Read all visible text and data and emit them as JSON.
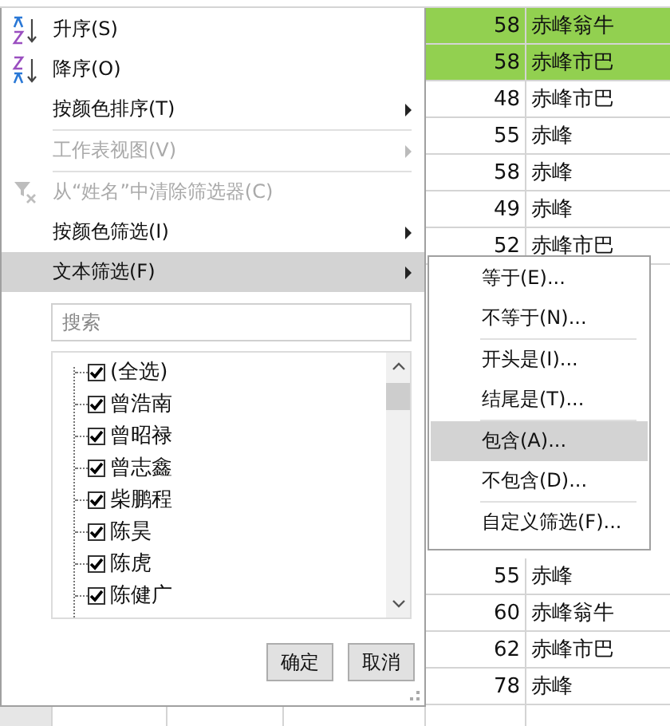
{
  "sheet": {
    "rows_top": [
      {
        "weight": "58",
        "address": "赤峰翁牛",
        "highlighted": true
      },
      {
        "weight": "58",
        "address": "赤峰市巴",
        "highlighted": true
      },
      {
        "weight": "48",
        "address": "赤峰市巴",
        "highlighted": false
      },
      {
        "weight": "55",
        "address": "赤峰",
        "highlighted": false
      },
      {
        "weight": "58",
        "address": "赤峰",
        "highlighted": false
      },
      {
        "weight": "49",
        "address": "赤峰",
        "highlighted": false
      },
      {
        "weight": "52",
        "address": "赤峰市巴",
        "highlighted": false
      }
    ],
    "rows_bottom": [
      {
        "weight": "55",
        "address": "赤峰",
        "highlighted": false
      },
      {
        "weight": "60",
        "address": "赤峰翁牛",
        "highlighted": false
      },
      {
        "weight": "62",
        "address": "赤峰市巴",
        "highlighted": false
      },
      {
        "weight": "78",
        "address": "赤峰",
        "highlighted": false
      }
    ]
  },
  "filter_menu": {
    "items": [
      {
        "kind": "sort_asc",
        "label": "升序(S)",
        "disabled": false,
        "selected": false
      },
      {
        "kind": "sort_desc",
        "label": "降序(O)",
        "disabled": false,
        "selected": false
      },
      {
        "kind": "submenu",
        "label": "按颜色排序(T)",
        "disabled": false,
        "selected": false
      },
      {
        "kind": "separator"
      },
      {
        "kind": "submenu",
        "label": "工作表视图(V)",
        "disabled": true,
        "selected": false
      },
      {
        "kind": "separator"
      },
      {
        "kind": "clear_filter",
        "label": "从“姓名”中清除筛选器(C)",
        "disabled": true,
        "selected": false
      },
      {
        "kind": "submenu",
        "label": "按颜色筛选(I)",
        "disabled": false,
        "selected": false
      },
      {
        "kind": "submenu",
        "label": "文本筛选(F)",
        "disabled": false,
        "selected": true
      }
    ],
    "search": {
      "placeholder": "搜索"
    },
    "values": [
      {
        "label": "(全选)",
        "checked": true
      },
      {
        "label": "曾浩南",
        "checked": true
      },
      {
        "label": "曾昭禄",
        "checked": true
      },
      {
        "label": "曾志鑫",
        "checked": true
      },
      {
        "label": "柴鹏程",
        "checked": true
      },
      {
        "label": "陈昊",
        "checked": true
      },
      {
        "label": "陈虎",
        "checked": true
      },
      {
        "label": "陈健广",
        "checked": true
      }
    ],
    "buttons": [
      "确定",
      "取消"
    ]
  },
  "text_filter_submenu": {
    "items": [
      {
        "kind": "item",
        "label": "等于(E)...",
        "selected": false
      },
      {
        "kind": "item",
        "label": "不等于(N)...",
        "selected": false
      },
      {
        "kind": "separator"
      },
      {
        "kind": "item",
        "label": "开头是(I)...",
        "selected": false
      },
      {
        "kind": "item",
        "label": "结尾是(T)...",
        "selected": false
      },
      {
        "kind": "separator"
      },
      {
        "kind": "item",
        "label": "包含(A)...",
        "selected": true
      },
      {
        "kind": "item",
        "label": "不包含(D)...",
        "selected": false
      },
      {
        "kind": "separator"
      },
      {
        "kind": "item",
        "label": "自定义筛选(F)...",
        "selected": false
      }
    ]
  }
}
